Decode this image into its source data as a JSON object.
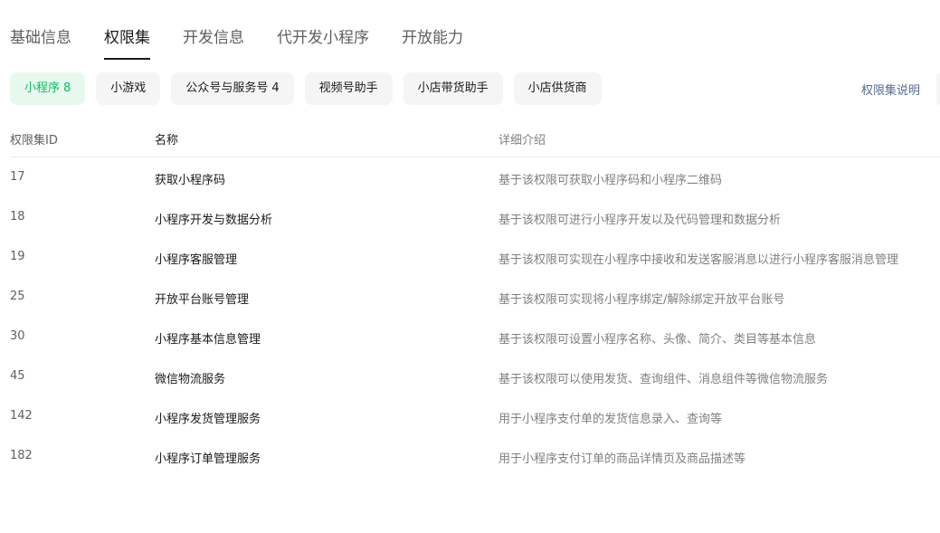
{
  "tabs": [
    {
      "label": "基础信息"
    },
    {
      "label": "权限集"
    },
    {
      "label": "开发信息"
    },
    {
      "label": "代开发小程序"
    },
    {
      "label": "开放能力"
    }
  ],
  "active_tab": "权限集",
  "chips": [
    {
      "label": "小程序",
      "count": "8"
    },
    {
      "label": "小游戏",
      "count": ""
    },
    {
      "label": "公众号与服务号",
      "count": "4"
    },
    {
      "label": "视频号助手",
      "count": ""
    },
    {
      "label": "小店带货助手",
      "count": ""
    },
    {
      "label": "小店供货商",
      "count": ""
    }
  ],
  "help_link": "权限集说明",
  "table": {
    "headers": {
      "id": "权限集ID",
      "name": "名称",
      "desc": "详细介绍"
    },
    "rows": [
      {
        "id": "17",
        "name": "获取小程序码",
        "desc": "基于该权限可获取小程序码和小程序二维码"
      },
      {
        "id": "18",
        "name": "小程序开发与数据分析",
        "desc": "基于该权限可进行小程序开发以及代码管理和数据分析"
      },
      {
        "id": "19",
        "name": "小程序客服管理",
        "desc": "基于该权限可实现在小程序中接收和发送客服消息以进行小程序客服消息管理"
      },
      {
        "id": "25",
        "name": "开放平台账号管理",
        "desc": "基于该权限可实现将小程序绑定/解除绑定开放平台账号"
      },
      {
        "id": "30",
        "name": "小程序基本信息管理",
        "desc": "基于该权限可设置小程序名称、头像、简介、类目等基本信息"
      },
      {
        "id": "45",
        "name": "微信物流服务",
        "desc": "基于该权限可以使用发货、查询组件、消息组件等微信物流服务"
      },
      {
        "id": "142",
        "name": "小程序发货管理服务",
        "desc": "用于小程序支付单的发货信息录入、查询等"
      },
      {
        "id": "182",
        "name": "小程序订单管理服务",
        "desc": "用于小程序支付订单的商品详情页及商品描述等"
      }
    ]
  },
  "colors": {
    "accent": "#07c160",
    "accent_bg": "#e7f8ee",
    "link": "#576b95"
  }
}
